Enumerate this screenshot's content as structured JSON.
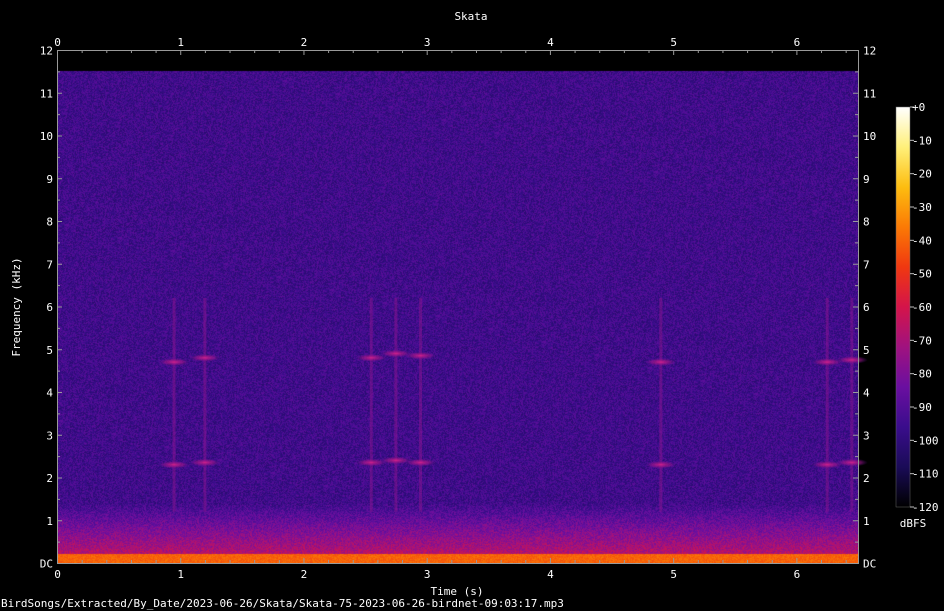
{
  "chart_data": {
    "type": "heatmap",
    "title": "Skata",
    "xlabel": "Time (s)",
    "ylabel": "Frequency (kHz)",
    "x_range": [
      0,
      6.5
    ],
    "y_range_khz": [
      0,
      12
    ],
    "x_ticks": [
      "0",
      "1",
      "2",
      "3",
      "4",
      "5",
      "6"
    ],
    "y_ticks": [
      "DC",
      "1",
      "2",
      "3",
      "4",
      "5",
      "6",
      "7",
      "8",
      "9",
      "10",
      "11",
      "12"
    ],
    "colorbar": {
      "label": "dBFS",
      "range": [
        -120,
        0
      ],
      "ticks": [
        "+0",
        "-10",
        "-20",
        "-30",
        "-40",
        "-50",
        "-60",
        "-70",
        "-80",
        "-90",
        "-100",
        "-110",
        "-120"
      ],
      "colors": [
        "#000000",
        "#1a0b57",
        "#3a0d8c",
        "#6a0fa0",
        "#a0127f",
        "#d4144a",
        "#f03810",
        "#fb7a05",
        "#fdbd10",
        "#fff07a",
        "#ffffff"
      ]
    },
    "background_level_dbfs": -95,
    "calls": [
      {
        "time_s": 0.95,
        "freqs_khz": [
          4.7,
          2.3
        ],
        "level_dbfs": -70
      },
      {
        "time_s": 1.2,
        "freqs_khz": [
          4.8,
          2.35
        ],
        "level_dbfs": -70
      },
      {
        "time_s": 2.55,
        "freqs_khz": [
          4.8,
          2.35
        ],
        "level_dbfs": -68
      },
      {
        "time_s": 2.75,
        "freqs_khz": [
          4.9,
          2.4
        ],
        "level_dbfs": -68
      },
      {
        "time_s": 2.95,
        "freqs_khz": [
          4.85,
          2.35
        ],
        "level_dbfs": -66
      },
      {
        "time_s": 4.9,
        "freqs_khz": [
          4.7,
          2.3
        ],
        "level_dbfs": -70
      },
      {
        "time_s": 6.25,
        "freqs_khz": [
          4.7,
          2.3
        ],
        "level_dbfs": -70
      },
      {
        "time_s": 6.45,
        "freqs_khz": [
          4.75,
          2.35
        ],
        "level_dbfs": -72
      }
    ],
    "low_band": {
      "freq_khz": 0.1,
      "level_dbfs": -40
    }
  },
  "footer": {
    "file_path": "BirdSongs/Extracted/By_Date/2023-06-26/Skata/Skata-75-2023-06-26-birdnet-09:03:17.mp3"
  }
}
